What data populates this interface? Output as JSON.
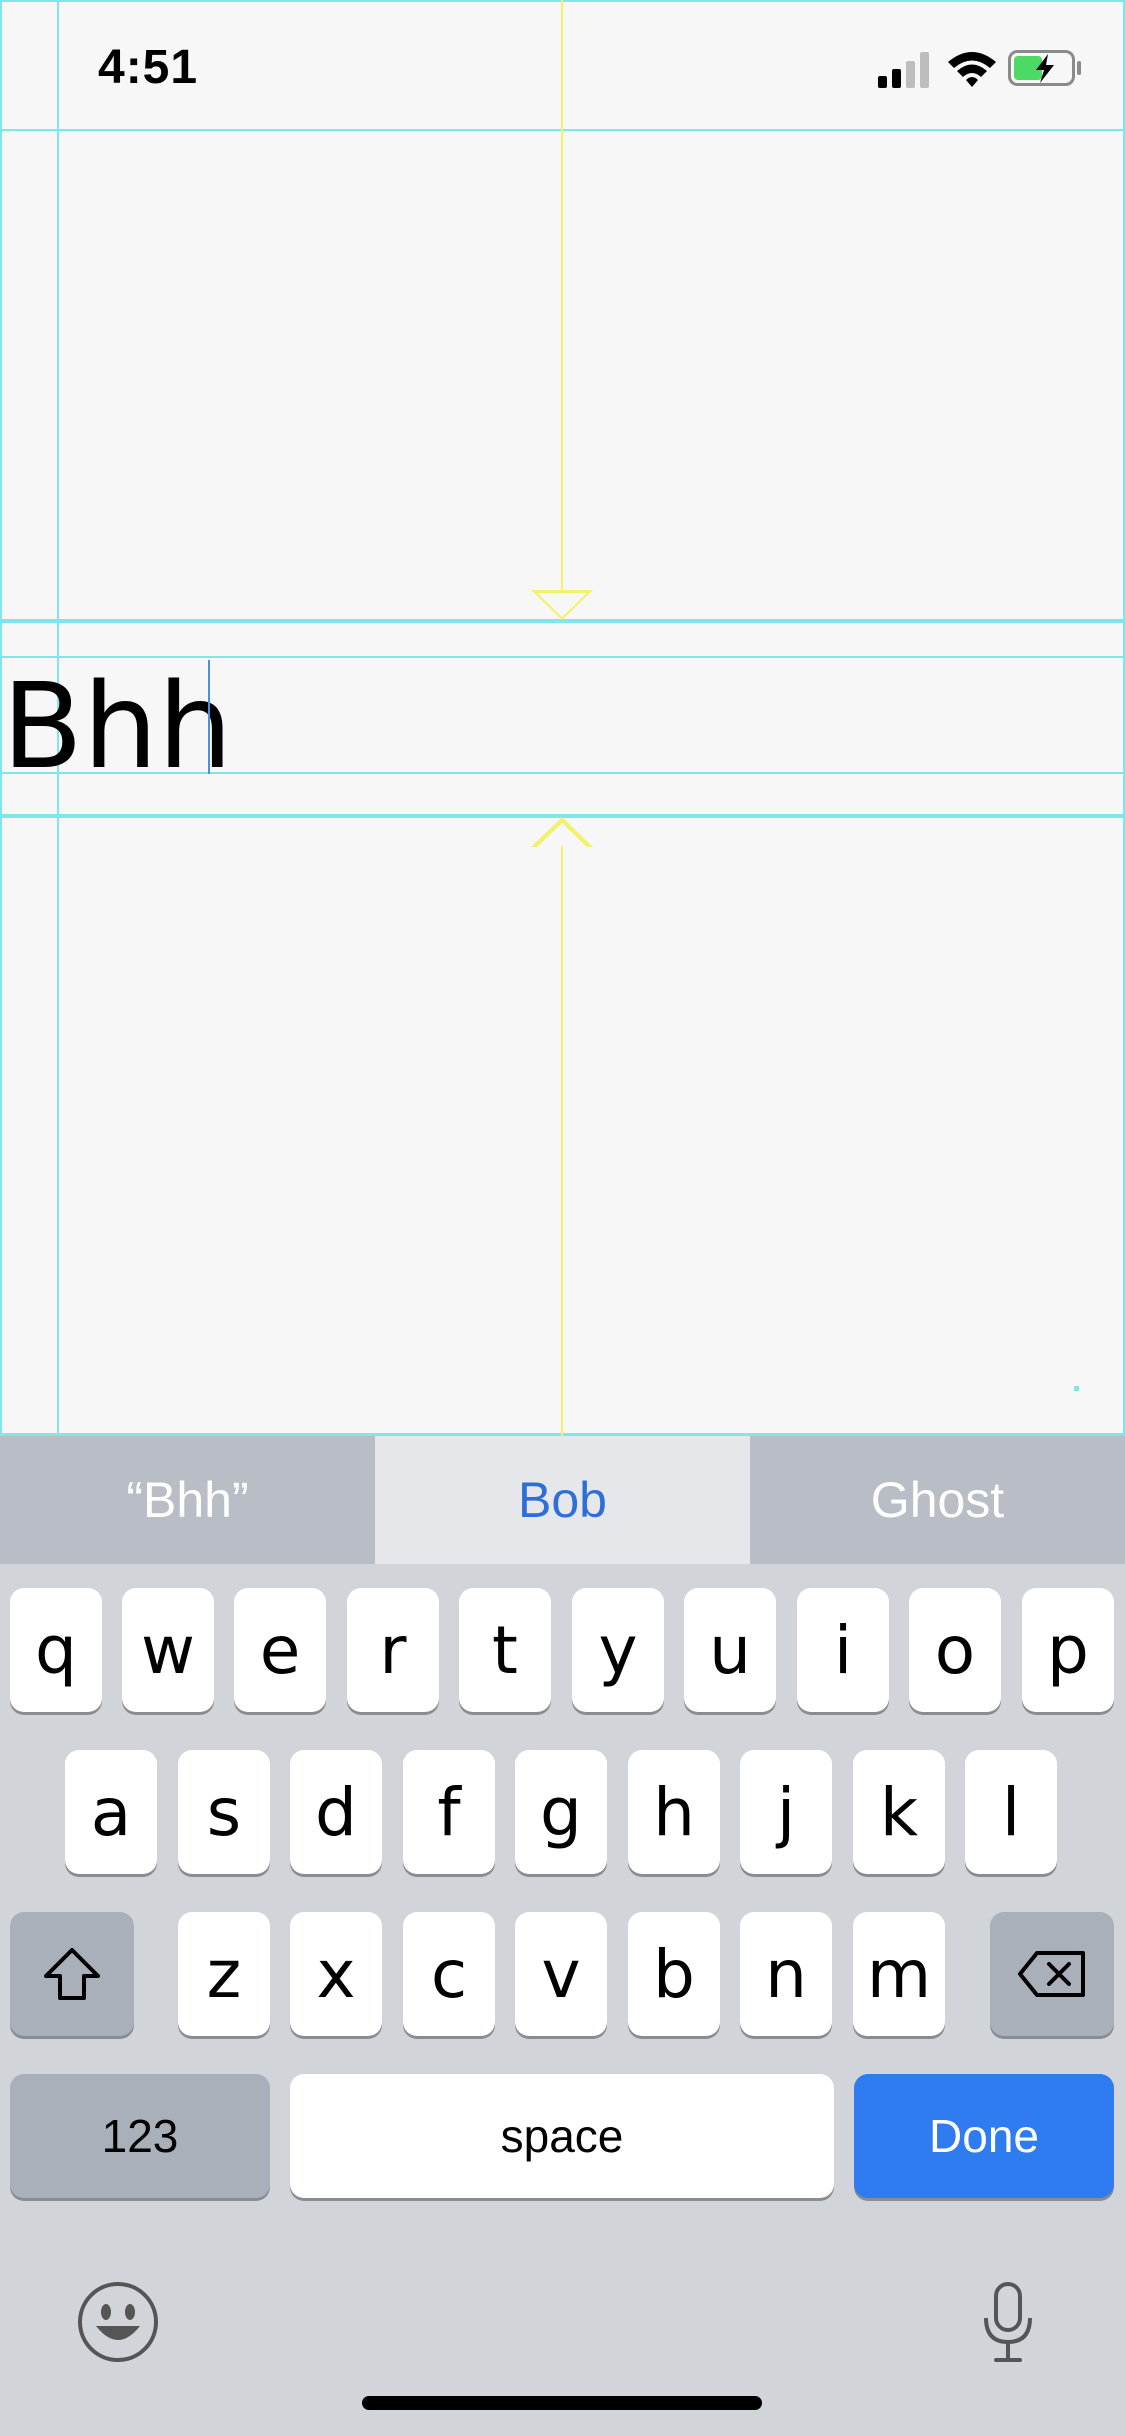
{
  "status_bar": {
    "time": "4:51",
    "signal_icon": "cellular-signal-icon",
    "wifi_icon": "wifi-icon",
    "battery_icon": "battery-charging-icon"
  },
  "text_field": {
    "value": "Bhh"
  },
  "predictions": [
    "“Bhh”",
    "Bob",
    "Ghost"
  ],
  "keyboard": {
    "row1": [
      "q",
      "w",
      "e",
      "r",
      "t",
      "y",
      "u",
      "i",
      "o",
      "p"
    ],
    "row2": [
      "a",
      "s",
      "d",
      "f",
      "g",
      "h",
      "j",
      "k",
      "l"
    ],
    "row3": [
      "z",
      "x",
      "c",
      "v",
      "b",
      "n",
      "m"
    ],
    "num_label": "123",
    "space_label": "space",
    "done_label": "Done"
  },
  "colors": {
    "guide": "#7fe7ec",
    "guide_yellow": "#f3f06a",
    "accent": "#2f7bf0"
  }
}
